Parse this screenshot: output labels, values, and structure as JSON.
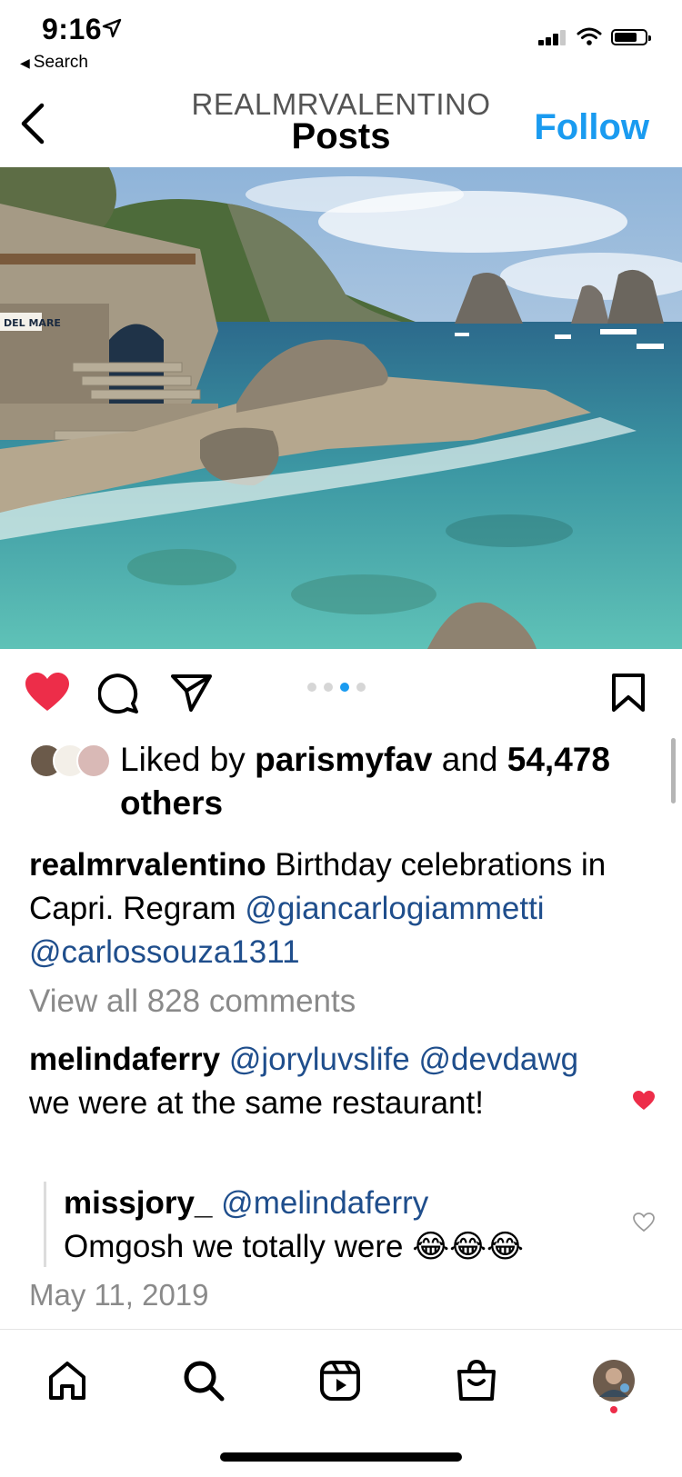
{
  "status_bar": {
    "time": "9:16",
    "back_app": "Search",
    "icons": [
      "location-arrow-icon",
      "cellular-signal-icon",
      "wifi-icon",
      "battery-icon"
    ]
  },
  "header": {
    "username": "REALMRVALENTINO",
    "title": "Posts",
    "follow_label": "Follow",
    "back_icon": "chevron-left-icon"
  },
  "colors": {
    "accent": "#1a9bf0",
    "like_red": "#ed2d49",
    "mention": "#1f4e8c",
    "muted": "#8a8a8a"
  },
  "post": {
    "liked": true,
    "carousel": {
      "total": 4,
      "current": 3
    },
    "likes": {
      "prefix": "Liked by ",
      "user": "parismyfav",
      "middle": " and ",
      "count": "54,478",
      "suffix": "others"
    },
    "caption": {
      "author": "realmrvalentino",
      "text": "Birthday celebrations in Capri. Regram",
      "mention1": "@giancarlogiammetti",
      "mention2": "@carlossouza1311"
    },
    "view_all_comments": "View all 828 comments",
    "comments": [
      {
        "author": "melindaferry",
        "mention1": "@joryluvslife",
        "mention2": "@devdawg",
        "text": "we were at the same restaurant!",
        "liked": true
      }
    ],
    "reply": {
      "author": "missjory_",
      "mention": "@melindaferry",
      "text": "Omgosh we totally were",
      "emoji": "😂😂😂",
      "liked": false
    },
    "date": "May 11, 2019",
    "photo_description_sign": "DEL MARE"
  },
  "bottom_nav": {
    "items": [
      "home-icon",
      "search-icon",
      "reels-icon",
      "shop-icon",
      "profile-avatar"
    ]
  }
}
